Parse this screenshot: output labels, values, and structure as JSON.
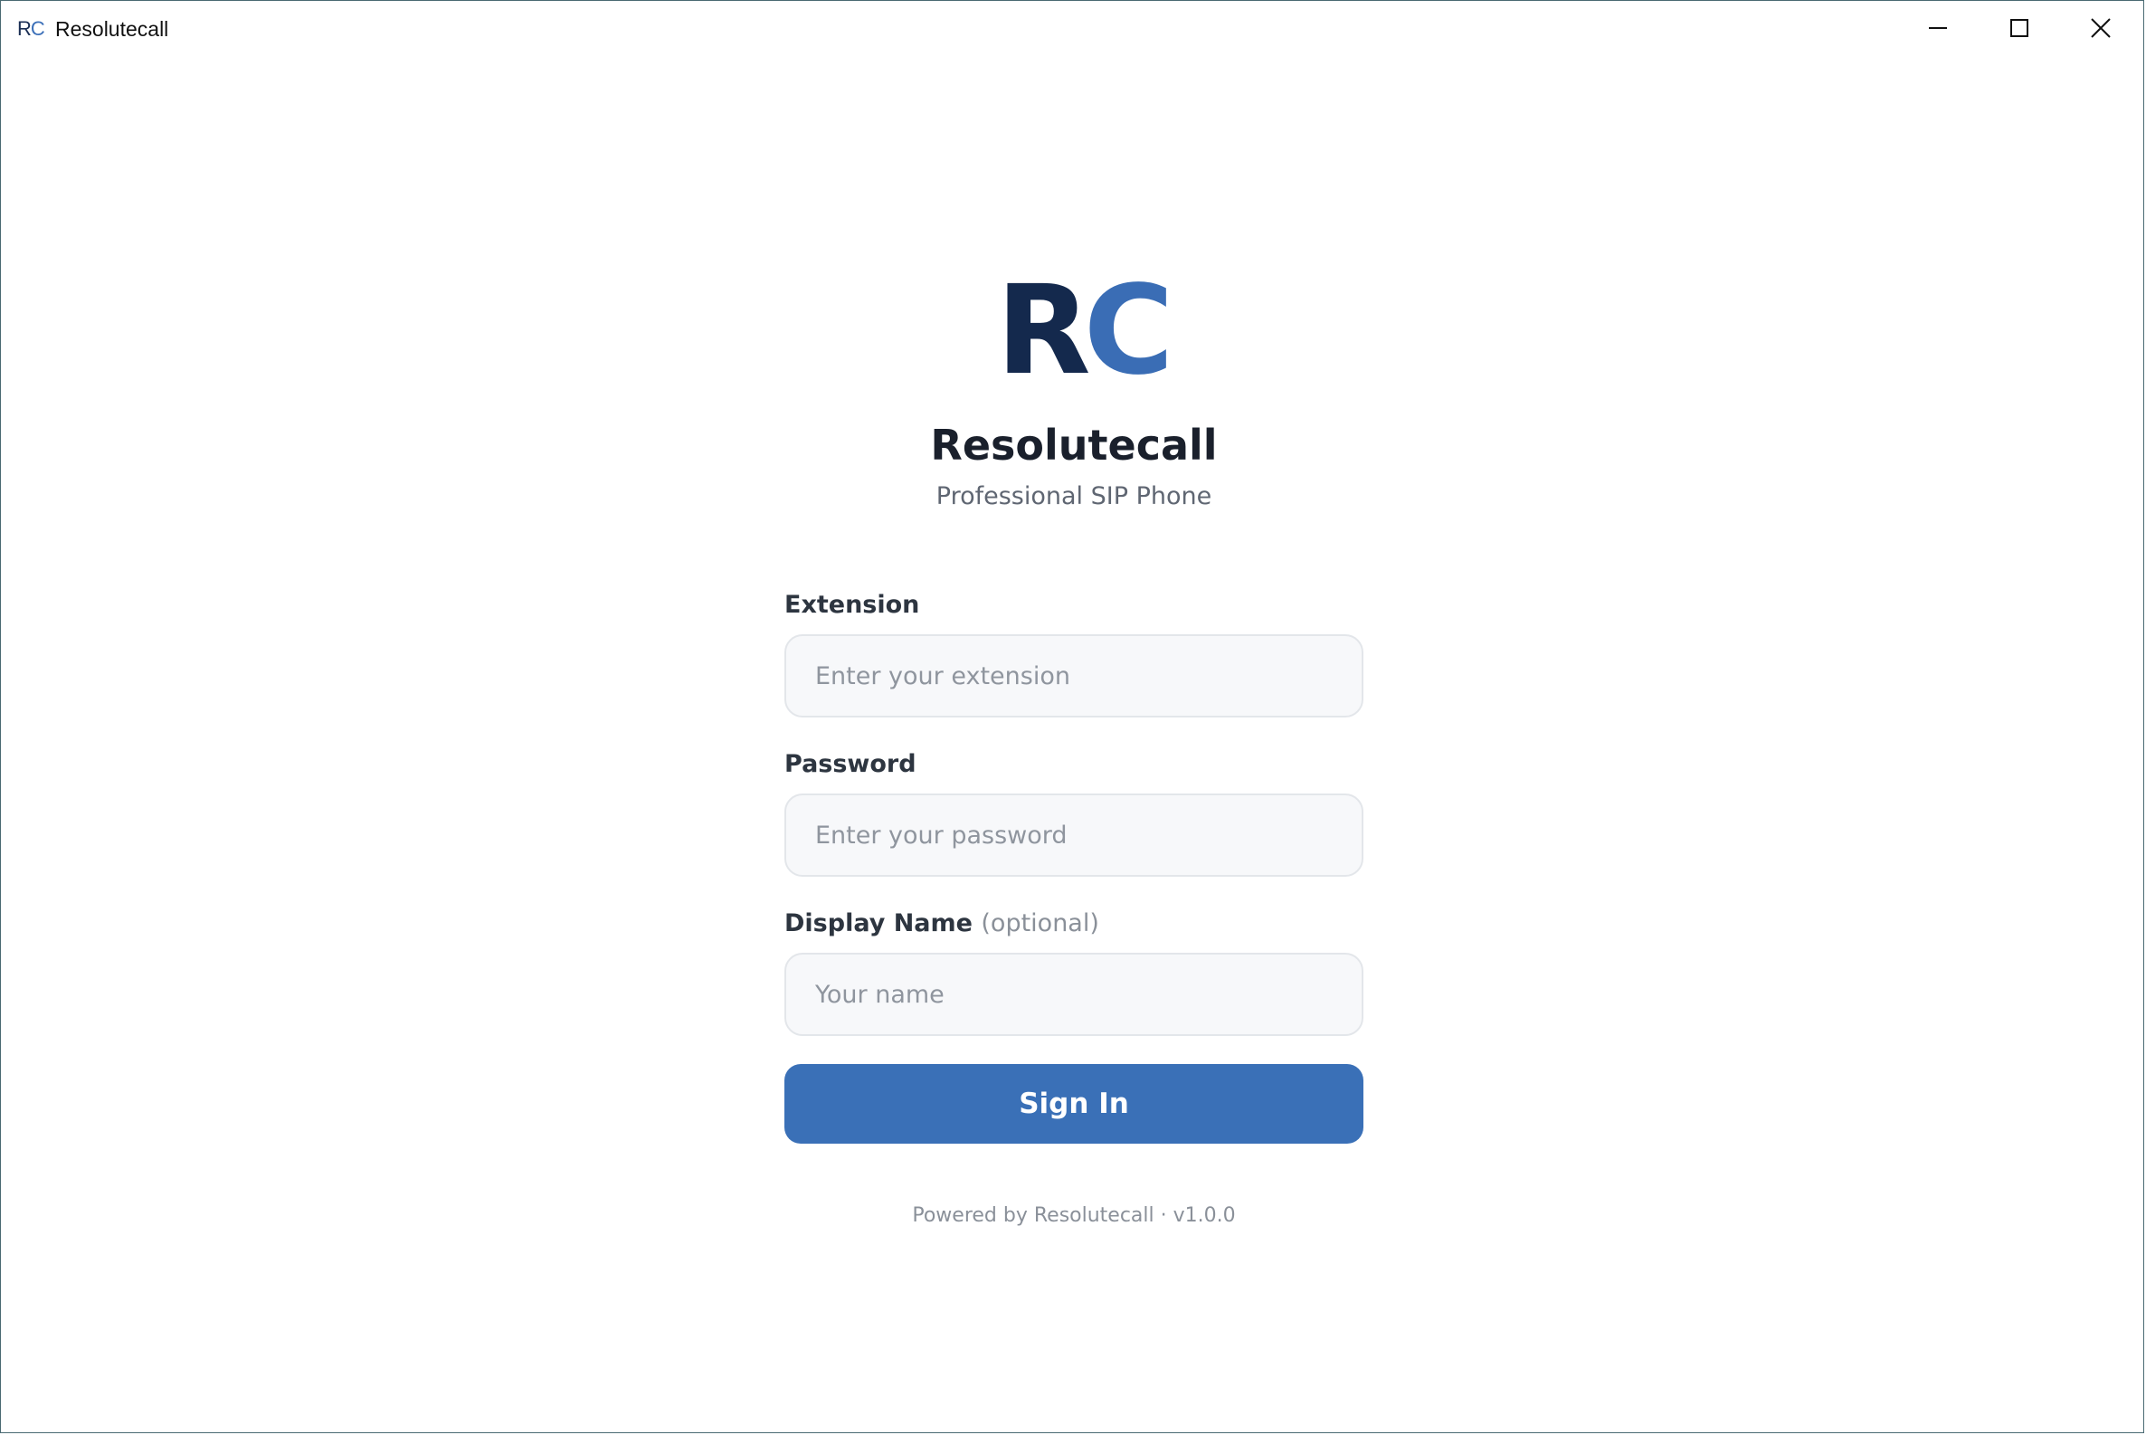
{
  "window": {
    "title": "Resolutecall",
    "icon_text": {
      "r": "R",
      "c": "C"
    },
    "controls": {
      "minimize": "minimize-icon",
      "maximize": "maximize-icon",
      "close": "close-icon"
    }
  },
  "login": {
    "logo": {
      "r": "R",
      "c": "C"
    },
    "app_name": "Resolutecall",
    "subtitle": "Professional SIP Phone",
    "fields": {
      "extension": {
        "label": "Extension",
        "placeholder": "Enter your extension",
        "value": ""
      },
      "password": {
        "label": "Password",
        "placeholder": "Enter your password",
        "value": ""
      },
      "display_name": {
        "label": "Display Name",
        "optional": "(optional)",
        "placeholder": "Your name",
        "value": ""
      }
    },
    "sign_in_label": "Sign In",
    "footer": "Powered by Resolutecall · v1.0.0"
  },
  "colors": {
    "logo_dark": "#14294d",
    "logo_blue": "#3a6db5",
    "button": "#3a70b7",
    "input_bg": "#f7f8fa",
    "input_border": "#e3e6ea"
  }
}
